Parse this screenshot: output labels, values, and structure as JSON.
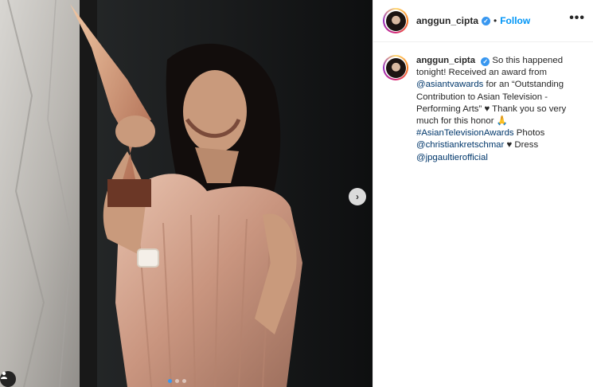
{
  "post": {
    "username": "anggun_cipta",
    "follow_label": "Follow",
    "separator": "•",
    "more_label": "•••",
    "verified_mark": "✓",
    "next_label": "›"
  },
  "caption": {
    "username": "anggun_cipta",
    "text_1": "So this happened tonight! Received an award from",
    "mention_1": "@asiantvawards",
    "text_2": "for an “Outstanding Contribution to Asian Television - Performing Arts” ♥ Thank you so very much for this honor 🙏",
    "hashtag": "#AsianTelevisionAwards",
    "text_3": "Photos",
    "mention_2": "@christiankretschmar",
    "text_4": "♥ Dress",
    "mention_3": "@jpgaultierofficial"
  },
  "carousel": {
    "count": 3,
    "active_index": 0
  },
  "colors": {
    "accent": "#0095f6",
    "verified": "#3897f0",
    "link": "#00376b"
  },
  "icons": {
    "tag": "person-tag-icon",
    "next": "chevron-right-icon",
    "more": "more-options-icon"
  }
}
